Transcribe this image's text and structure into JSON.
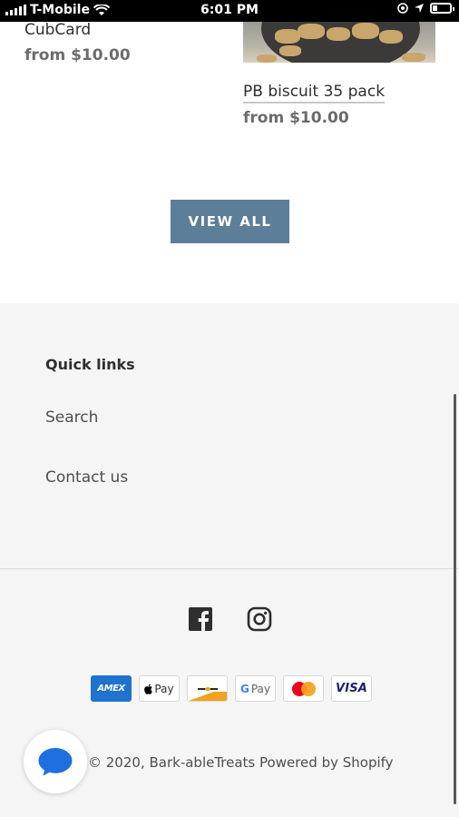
{
  "status_bar": {
    "carrier": "T-Mobile",
    "time": "6:01 PM"
  },
  "products": [
    {
      "title": "CubCard",
      "price": "from $10.00"
    },
    {
      "title": "PB biscuit 35 pack",
      "price": "from $10.00"
    }
  ],
  "view_all_label": "VIEW ALL",
  "footer": {
    "quick_links_title": "Quick links",
    "links": [
      "Search",
      "Contact us"
    ],
    "social": [
      "facebook-icon",
      "instagram-icon"
    ],
    "payment_methods": [
      "American Express",
      "Apple Pay",
      "Diners Club",
      "Google Pay",
      "Mastercard",
      "Visa"
    ],
    "payment_labels": {
      "amex": "AMEX",
      "apple": "Pay",
      "gpay": "Pay",
      "visa": "VISA"
    },
    "copyright": "© 2020, Bark-ableTreats",
    "powered_by": "Powered by Shopify"
  },
  "colors": {
    "accent_button": "#5d7e99",
    "footer_bg": "#f5f5f5",
    "chat_blue": "#1f6fe0"
  }
}
